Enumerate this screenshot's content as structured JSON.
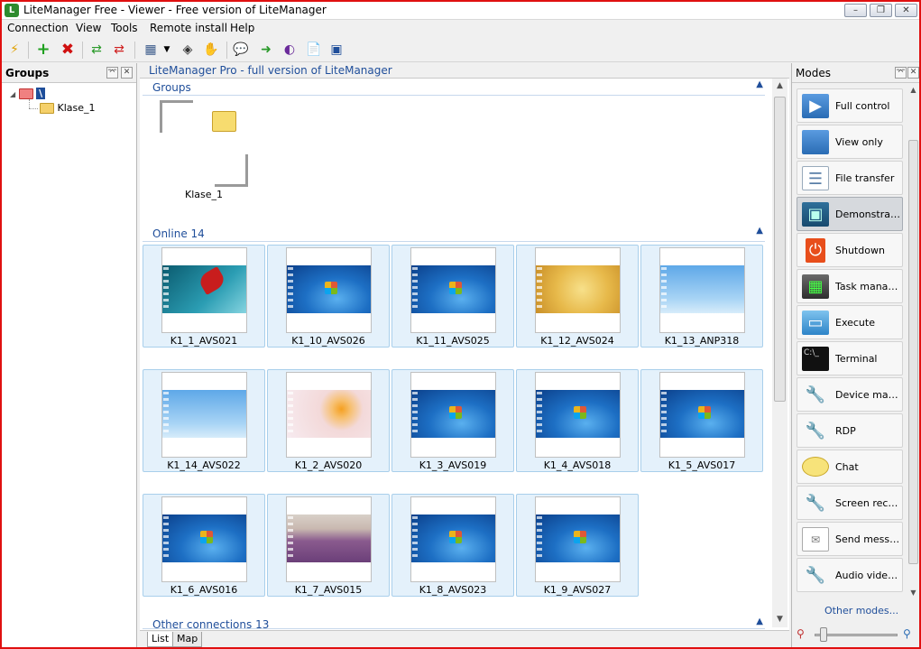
{
  "window": {
    "title": "LiteManager Free - Viewer - Free version of LiteManager",
    "minimize": "–",
    "maximize": "❐",
    "close": "✕"
  },
  "menu": [
    "Connection",
    "View",
    "Tools",
    "Remote install",
    "Help"
  ],
  "groups_panel": {
    "title": "Groups",
    "pin": "⌤",
    "close": "✕",
    "root": "\\",
    "child": "Klase_1"
  },
  "center": {
    "banner": "LiteManager Pro - full version of LiteManager",
    "groups_section": "Groups",
    "group_tile": "Klase_1",
    "online_section": "Online 14",
    "other_section": "Other connections 13",
    "computers": [
      {
        "name": "K1_1_AVS021"
      },
      {
        "name": "K1_10_AVS026"
      },
      {
        "name": "K1_11_AVS025"
      },
      {
        "name": "K1_12_AVS024"
      },
      {
        "name": "K1_13_ANP318"
      },
      {
        "name": "K1_14_AVS022"
      },
      {
        "name": "K1_2_AVS020"
      },
      {
        "name": "K1_3_AVS019"
      },
      {
        "name": "K1_4_AVS018"
      },
      {
        "name": "K1_5_AVS017"
      },
      {
        "name": "K1_6_AVS016"
      },
      {
        "name": "K1_7_AVS015"
      },
      {
        "name": "K1_8_AVS023"
      },
      {
        "name": "K1_9_AVS027"
      }
    ],
    "tabs": [
      "List",
      "Map"
    ]
  },
  "modes_panel": {
    "title": "Modes",
    "items": [
      {
        "label": "Full control",
        "icon": "full-control-icon"
      },
      {
        "label": "View only",
        "icon": "view-only-icon"
      },
      {
        "label": "File transfer",
        "icon": "file-transfer-icon"
      },
      {
        "label": "Demonstration",
        "icon": "demonstration-icon"
      },
      {
        "label": "Shutdown",
        "icon": "shutdown-icon"
      },
      {
        "label": "Task manager",
        "icon": "task-manager-icon"
      },
      {
        "label": "Execute",
        "icon": "execute-icon"
      },
      {
        "label": "Terminal",
        "icon": "terminal-icon"
      },
      {
        "label": "Device mana...",
        "icon": "device-manager-icon"
      },
      {
        "label": "RDP",
        "icon": "rdp-icon"
      },
      {
        "label": "Chat",
        "icon": "chat-icon"
      },
      {
        "label": "Screen recor...",
        "icon": "screen-recorder-icon"
      },
      {
        "label": "Send message",
        "icon": "send-message-icon"
      },
      {
        "label": "Audio video ...",
        "icon": "audio-video-icon"
      }
    ],
    "other_modes": "Other modes..."
  },
  "colors": {
    "accent": "#1f4e9a",
    "tile_bg": "#e4f1fb",
    "active_mode": "#d6d9dd",
    "frame": "#e01010"
  }
}
